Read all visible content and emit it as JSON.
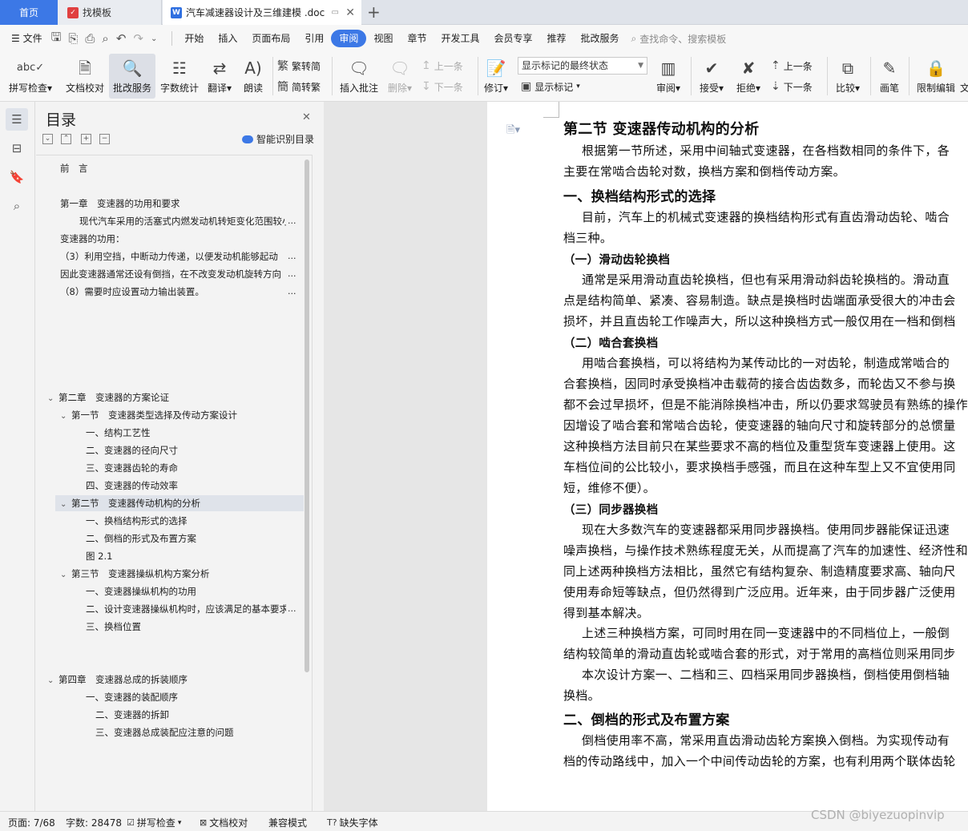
{
  "tabs": {
    "home": "首页",
    "find": "找模板",
    "doc": "汽车减速器设计及三维建模 .doc"
  },
  "menu": {
    "file": "文件",
    "items": [
      "开始",
      "插入",
      "页面布局",
      "引用",
      "审阅",
      "视图",
      "章节",
      "开发工具",
      "会员专享",
      "推荐",
      "批改服务"
    ],
    "active": "审阅",
    "search": "查找命令、搜索模板"
  },
  "ribbon": {
    "spell": "拼写检查",
    "proof": "文档校对",
    "review_service": "批改服务",
    "word_count": "字数统计",
    "translate": "翻译",
    "read_aloud": "朗读",
    "to_traditional": "繁转简",
    "to_simplified": "简转繁",
    "insert_comment": "插入批注",
    "delete": "删除",
    "prev": "上一条",
    "next": "下一条",
    "revise": "修订",
    "markup_select": "显示标记的最终状态",
    "show_markup": "显示标记",
    "review": "审阅",
    "accept": "接受",
    "reject": "拒绝",
    "prev2": "上一条",
    "next2": "下一条",
    "compare": "比较",
    "pen": "画笔",
    "restrict": "限制编辑",
    "more": "文"
  },
  "toc": {
    "title": "目录",
    "smart": "智能识别目录",
    "items": [
      "前　言",
      "第一章　变速器的功用和要求",
      "现代汽车采用的活塞式内燃发动机转矩变化范围较小",
      "变速器的功用：",
      "（3）利用空挡，中断动力传递，以便发动机能够起动",
      "因此变速器通常还设有倒挡，在不改变发动机旋转方向",
      "（8）需要时应设置动力输出装置。",
      "第二章　变速器的方案论证",
      "第一节　变速器类型选择及传动方案设计",
      "一、结构工艺性",
      "二、变速器的径向尺寸",
      "三、变速器齿轮的寿命",
      "四、变速器的传动效率",
      "第二节　变速器传动机构的分析",
      "一、换档结构形式的选择",
      "二、倒档的形式及布置方案",
      "图 2.1",
      "第三节　变速器操纵机构方案分析",
      "一、变速器操纵机构的功用",
      "二、设计变速器操纵机构时，应该满足的基本要求",
      "三、换档位置",
      "第四章　变速器总成的拆装顺序",
      "一、变速器的装配顺序",
      "二、变速器的拆卸",
      "三、变速器总成装配应注意的问题"
    ],
    "ellipsis": "..."
  },
  "document": {
    "lines": [
      "第二节  变速器传动机构的分析",
      "根据第一节所述，采用中间轴式变速器，在各档数相同的条件下，各",
      "主要在常啮合齿轮对数，换档方案和倒档传动方案。",
      "一、换档结构形式的选择",
      "目前，汽车上的机械式变速器的换档结构形式有直齿滑动齿轮、啮合",
      "档三种。",
      "（一）滑动齿轮换档",
      "通常是采用滑动直齿轮换档，但也有采用滑动斜齿轮换档的。滑动直",
      "点是结构简单、紧凑、容易制造。缺点是换档时齿端面承受很大的冲击会",
      "损坏，并且直齿轮工作噪声大，所以这种换档方式一般仅用在一档和倒档",
      "（二）啮合套换档",
      "用啮合套换档，可以将结构为某传动比的一对齿轮，制造成常啮合的",
      "合套换档，因同时承受换档冲击载荷的接合齿齿数多，而轮齿又不参与换",
      "都不会过早损坏，但是不能消除换档冲击，所以仍要求驾驶员有熟练的操作",
      "因增设了啮合套和常啮合齿轮，使变速器的轴向尺寸和旋转部分的总惯量",
      "这种换档方法目前只在某些要求不高的档位及重型货车变速器上使用。这",
      "车档位间的公比较小，要求换档手感强，而且在这种车型上又不宜使用同",
      "短，维修不便）。",
      "（三）同步器换档",
      "现在大多数汽车的变速器都采用同步器换档。使用同步器能保证迅速",
      "噪声换档，与操作技术熟练程度无关，从而提高了汽车的加速性、经济性和",
      "同上述两种换档方法相比，虽然它有结构复杂、制造精度要求高、轴向尺",
      "使用寿命短等缺点，但仍然得到广泛应用。近年来，由于同步器广泛使用",
      "得到基本解决。",
      "上述三种换档方案，可同时用在同一变速器中的不同档位上，一般倒",
      "结构较简单的滑动直齿轮或啮合套的形式，对于常用的高档位则采用同步",
      "本次设计方案一、二档和三、四档采用同步器换档，倒档使用倒档轴",
      "换档。",
      "二、倒档的形式及布置方案",
      "倒档使用率不高，常采用直齿滑动齿轮方案换入倒档。为实现传动有",
      "档的传动路线中，加入一个中间传动齿轮的方案，也有利用两个联体齿轮"
    ]
  },
  "status": {
    "page": "页面: 7/68",
    "words": "字数: 28478",
    "spell": "拼写检查",
    "proof": "文档校对",
    "compat": "兼容模式",
    "missing_font": "缺失字体"
  },
  "watermark": "CSDN @biyezuopinvip"
}
